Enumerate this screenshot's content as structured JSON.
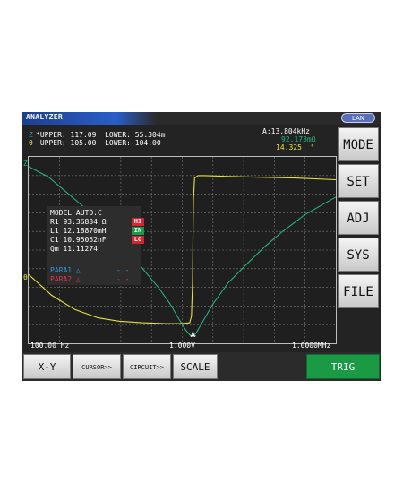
{
  "colors": {
    "trace_z": "#22b37a",
    "trace_theta": "#e8e33a",
    "cursor": "#ffffff",
    "hi": "#d9232e",
    "in": "#1a9a46",
    "lo": "#d9232e",
    "para1": "#2a9bd8",
    "para2": "#e0354f"
  },
  "header": {
    "title": "ANALYZER",
    "lan": "LAN"
  },
  "limits": {
    "z_tag": "Z",
    "z_line": "*UPPER: 117.09  LOWER: 55.304m",
    "theta_tag": "θ",
    "theta_line": " UPPER: 105.00  LOWER:-104.00"
  },
  "cursor_info": {
    "freq": "A:13.804kHz",
    "z_value": "92.173mΩ",
    "theta_value": "14.325  °"
  },
  "plot": {
    "z_axis_label": "Z",
    "theta_axis_label": "θ",
    "cursor_label": "A",
    "x_start": "100.00 Hz",
    "x_mid": "1.000V",
    "x_end": "1.0000MHz"
  },
  "model": {
    "header": "MODEL AUTO:C",
    "r1": "R1 93.36834 Ω",
    "l1": "L1 12.18870mH",
    "c1": "C1 10.95052nF",
    "qm": "Qm 11.11274",
    "r1_flag": "HI",
    "l1_flag": "IN",
    "c1_flag": "LO",
    "para1": "PARA1 △",
    "para1_val": "- -",
    "para2": "PARA2 △",
    "para2_val": "- -"
  },
  "side_menu": [
    "MODE",
    "SET",
    "ADJ",
    "SYS",
    "FILE"
  ],
  "bottom_menu": {
    "xy": "X-Y",
    "cursor": "CURSOR>>",
    "circuit": "CIRCUIT>>",
    "scale": "SCALE",
    "trig": "TRIG"
  },
  "chart_data": {
    "type": "line",
    "x_scale": "log",
    "xlim": [
      100,
      1000000
    ],
    "grid": true,
    "cursor_x": 13804,
    "series": [
      {
        "name": "Z",
        "x": [
          100,
          180,
          300,
          500,
          800,
          1200,
          2000,
          3000,
          5000,
          7000,
          9000,
          11000,
          12500,
          13400,
          13804,
          14300,
          15500,
          18000,
          25000,
          40000,
          70000,
          120000,
          200000,
          400000,
          1000000
        ],
        "y": [
          117,
          110,
          100,
          90,
          80,
          70,
          57,
          47,
          33,
          22,
          12,
          4.5,
          1.0,
          0.2,
          0.092,
          0.5,
          3.0,
          9,
          22,
          37,
          50,
          62,
          72,
          84,
          96
        ]
      },
      {
        "name": "θ",
        "x": [
          100,
          200,
          400,
          800,
          1500,
          3000,
          6000,
          10000,
          12500,
          13200,
          13600,
          13804,
          14000,
          14500,
          16000,
          20000,
          40000,
          100000,
          300000,
          1000000
        ],
        "y": [
          -30,
          -55,
          -72,
          -82,
          -86,
          -88,
          -89,
          -89,
          -88,
          -80,
          -40,
          14,
          60,
          86,
          89,
          89,
          88,
          87,
          86,
          84
        ]
      }
    ]
  }
}
